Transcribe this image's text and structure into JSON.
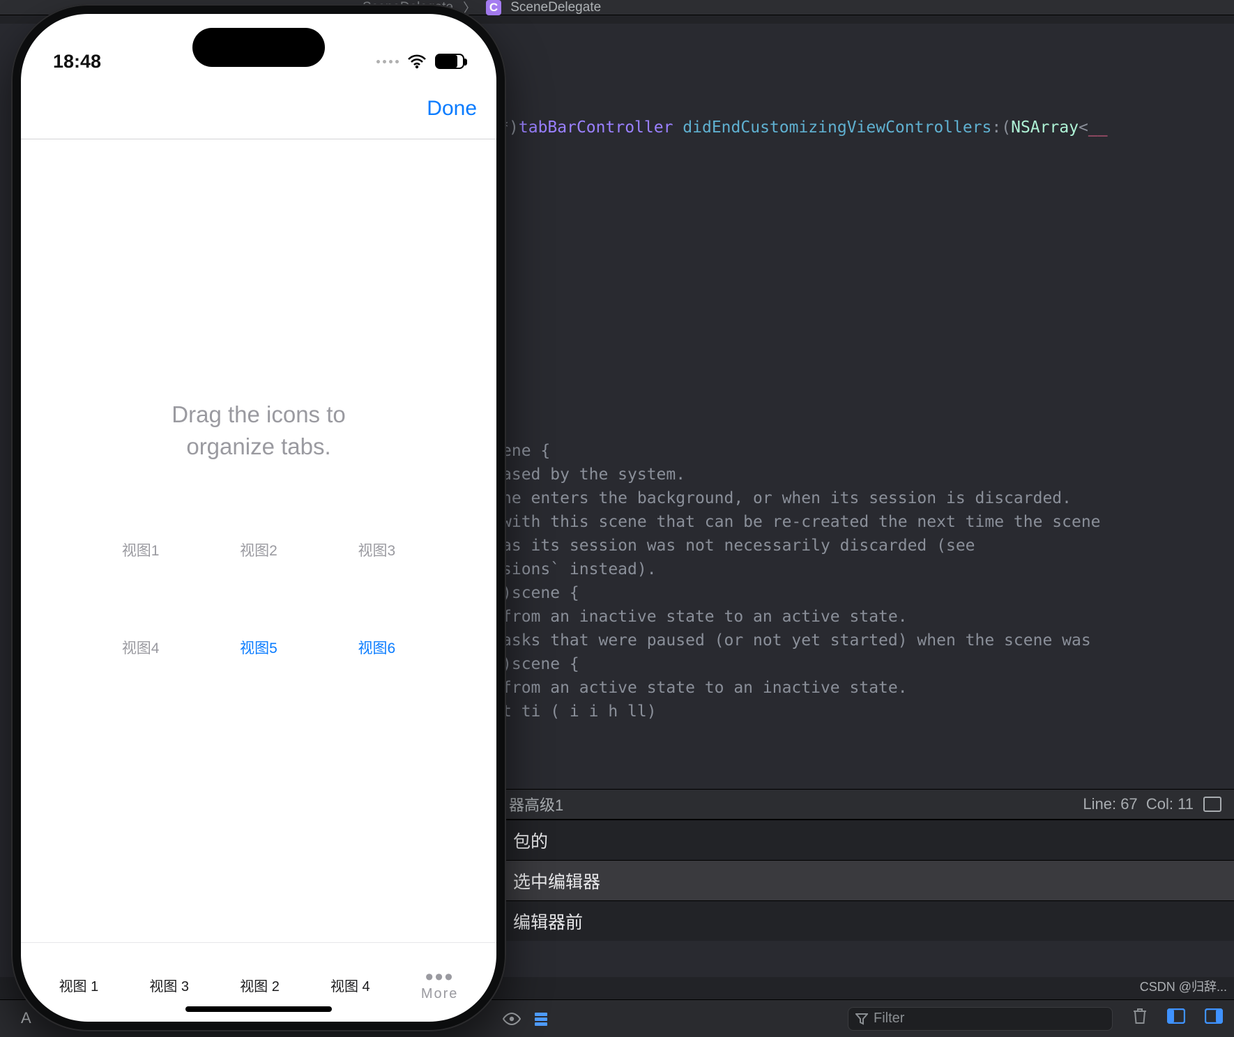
{
  "xcode": {
    "breadcrumbs": {
      "parent": "SceneDelegate",
      "current": "SceneDelegate"
    },
    "signature": {
      "pre": "oller *)",
      "param": "tabBarController",
      "method": "didEndCustomizingViewControllers",
      "suffix1": ":(",
      "type": "NSArray",
      "suffix2": "<",
      "tail": "__"
    },
    "code_lines": [
      "ene {",
      "ased by the system.",
      "ne enters the background, or when its session is discarded.",
      "with this scene that can be re-created the next time the scene",
      "",
      "as its session was not necessarily discarded (see",
      "sions` instead).",
      "",
      "",
      "",
      ")scene {",
      "from an inactive state to an active state.",
      "asks that were paused (or not yet started) when the scene was",
      "",
      "",
      "",
      "",
      ")scene {",
      "from an active state to an inactive state.",
      "t ti ( i i h ll)"
    ],
    "status": {
      "doc": "器高级1",
      "line_label": "Line:",
      "line": "67",
      "col_label": "Col:",
      "col": "11"
    },
    "panel_rows": [
      {
        "label": "包的",
        "selected": false
      },
      {
        "label": "选中编辑器",
        "selected": true
      },
      {
        "label": "编辑器前",
        "selected": false
      }
    ],
    "bottom": {
      "filter_label": "Filter",
      "a_label": "A"
    }
  },
  "phone": {
    "status_time": "18:48",
    "done_label": "Done",
    "hint_line1": "Drag the icons to",
    "hint_line2": "organize tabs.",
    "grid_items": [
      {
        "label": "视图1",
        "style": "dim"
      },
      {
        "label": "视图2",
        "style": "dim"
      },
      {
        "label": "视图3",
        "style": "dim"
      },
      {
        "label": "视图4",
        "style": "dim"
      },
      {
        "label": "视图5",
        "style": "blue"
      },
      {
        "label": "视图6",
        "style": "blue"
      }
    ],
    "tabs": [
      {
        "label": "视图 1"
      },
      {
        "label": "视图 3"
      },
      {
        "label": "视图 2"
      },
      {
        "label": "视图 4"
      }
    ],
    "more_label": "More"
  },
  "watermark": "CSDN @归辞..."
}
